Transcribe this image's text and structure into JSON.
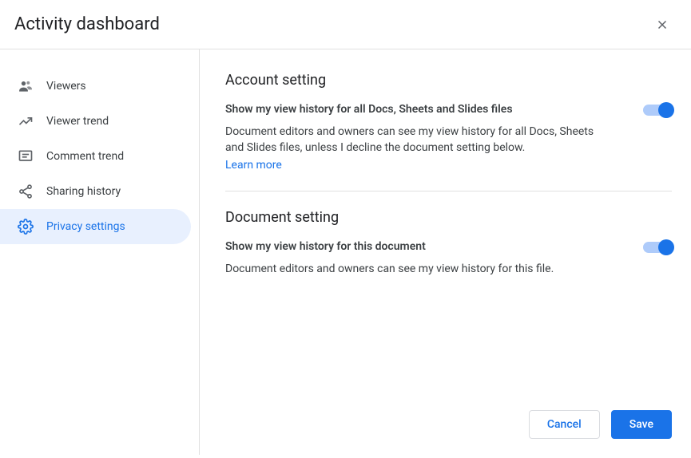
{
  "header": {
    "title": "Activity dashboard"
  },
  "sidebar": {
    "items": [
      {
        "label": "Viewers"
      },
      {
        "label": "Viewer trend"
      },
      {
        "label": "Comment trend"
      },
      {
        "label": "Sharing history"
      },
      {
        "label": "Privacy settings"
      }
    ]
  },
  "content": {
    "account": {
      "heading": "Account setting",
      "title": "Show my view history for all Docs, Sheets and Slides files",
      "desc": "Document editors and owners can see my view history for all Docs, Sheets and Slides files, unless I decline the document setting below.",
      "learn_more": "Learn more"
    },
    "document": {
      "heading": "Document setting",
      "title": "Show my view history for this document",
      "desc": "Document editors and owners can see my view history for this file."
    }
  },
  "footer": {
    "cancel": "Cancel",
    "save": "Save"
  }
}
